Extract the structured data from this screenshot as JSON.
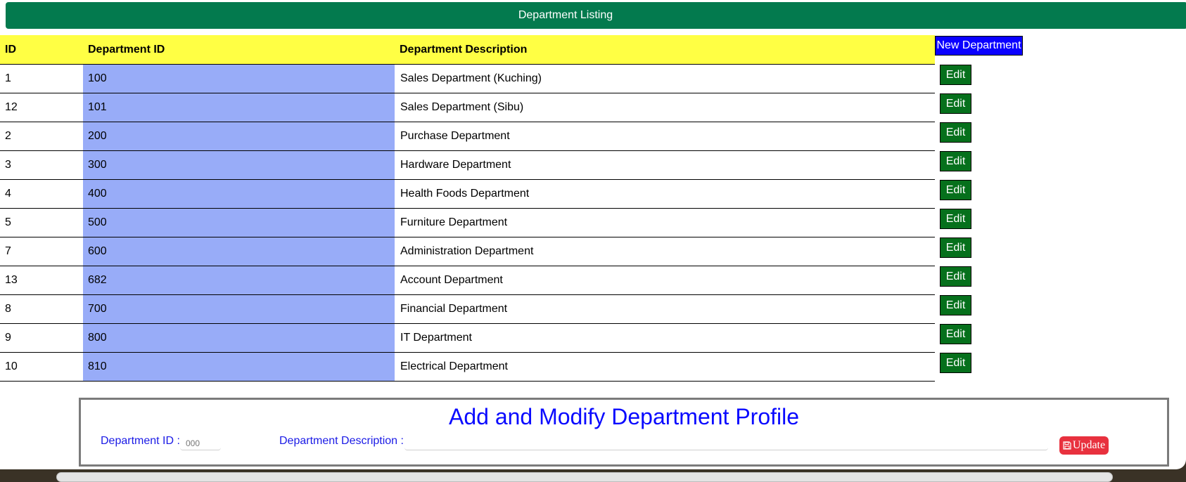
{
  "header": {
    "title": "Department Listing"
  },
  "table": {
    "columns": [
      "ID",
      "Department ID",
      "Department Description"
    ],
    "rows": [
      {
        "id": "1",
        "dept_id": "100",
        "desc": "Sales Department (Kuching)"
      },
      {
        "id": "12",
        "dept_id": "101",
        "desc": "Sales Department (Sibu)"
      },
      {
        "id": "2",
        "dept_id": "200",
        "desc": "Purchase Department"
      },
      {
        "id": "3",
        "dept_id": "300",
        "desc": "Hardware Department"
      },
      {
        "id": "4",
        "dept_id": "400",
        "desc": "Health Foods Department"
      },
      {
        "id": "5",
        "dept_id": "500",
        "desc": "Furniture Department"
      },
      {
        "id": "7",
        "dept_id": "600",
        "desc": "Administration Department"
      },
      {
        "id": "13",
        "dept_id": "682",
        "desc": "Account Department"
      },
      {
        "id": "8",
        "dept_id": "700",
        "desc": "Financial Department"
      },
      {
        "id": "9",
        "dept_id": "800",
        "desc": "IT Department"
      },
      {
        "id": "10",
        "dept_id": "810",
        "desc": "Electrical Department"
      }
    ]
  },
  "actions": {
    "new_label": "New Department",
    "edit_label": "Edit"
  },
  "form": {
    "title": "Add and Modify Department Profile",
    "dept_id_label": "Department ID :",
    "dept_id_placeholder": "000",
    "dept_desc_label": "Department Description :",
    "dept_desc_value": "",
    "update_label": "Update",
    "update_icon": "save-icon"
  },
  "colors": {
    "header_bar": "#037a4e",
    "table_header": "#ffff44",
    "dept_id_column": "#98acf8",
    "new_button": "#0a00ff",
    "edit_button": "#06701c",
    "form_title": "#0a0aff",
    "update_button": "#e8313e"
  }
}
